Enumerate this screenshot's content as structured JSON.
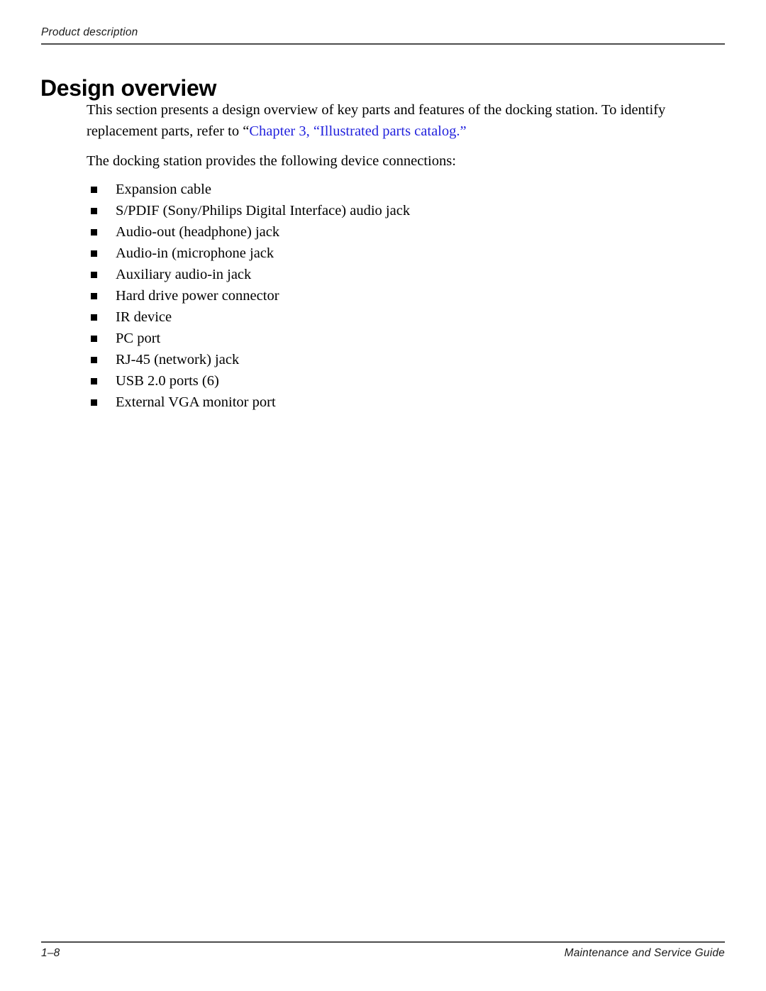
{
  "header": {
    "running_head": "Product description"
  },
  "heading": {
    "title": "Design overview"
  },
  "paragraphs": {
    "intro_before_link": "This section presents a design overview of key parts and features of the docking station. To identify replacement parts, refer to “",
    "intro_link": "Chapter 3, “Illustrated parts catalog.”",
    "intro_after_link": "",
    "list_lead_in": "The docking station provides the following device connections:"
  },
  "bullets": [
    {
      "label": "Expansion cable"
    },
    {
      "label": "S/PDIF (Sony/Philips Digital Interface) audio jack"
    },
    {
      "label": "Audio-out (headphone) jack"
    },
    {
      "label": "Audio-in (microphone jack"
    },
    {
      "label": "Auxiliary audio-in jack"
    },
    {
      "label": "Hard drive power connector"
    },
    {
      "label": "IR device"
    },
    {
      "label": "PC port"
    },
    {
      "label": "RJ-45 (network) jack"
    },
    {
      "label": "USB 2.0 ports (6)"
    },
    {
      "label": "External VGA monitor port"
    }
  ],
  "footer": {
    "page_number": "1–8",
    "guide_title": "Maintenance and Service Guide"
  },
  "colors": {
    "link": "#2222dd",
    "rule": "#4d4d4d",
    "text": "#000000",
    "background": "#ffffff"
  }
}
